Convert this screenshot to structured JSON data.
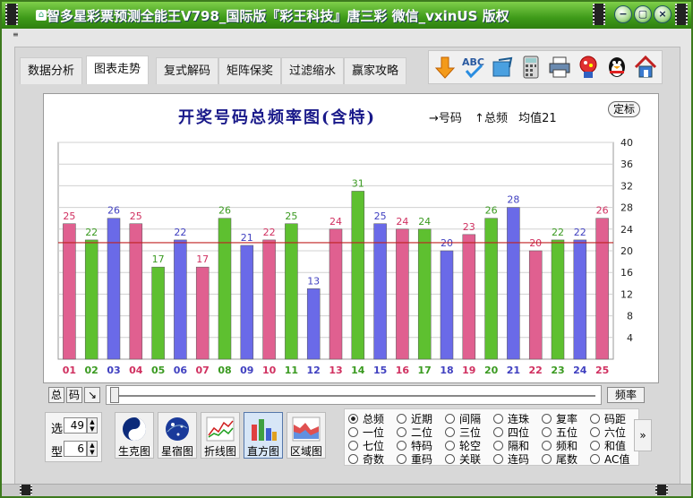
{
  "window": {
    "title": "智多星彩票预测全能王V798_国际版『彩王科技』唐三彩 微信_vxinUS 版权",
    "menu_icon": "≡",
    "controls": [
      "−",
      "▢",
      "×"
    ]
  },
  "tabs": [
    {
      "label": "数据分析"
    },
    {
      "label": "图表走势",
      "active": true
    },
    {
      "label": "复式解码"
    },
    {
      "label": "矩阵保奖"
    },
    {
      "label": "过滤缩水"
    },
    {
      "label": "赢家攻略"
    }
  ],
  "toolbar_icons": [
    "arrow-down-icon",
    "abc-check-icon",
    "export-icon",
    "calculator-icon",
    "printer-icon",
    "lottery-ball-icon",
    "qq-penguin-icon",
    "home-icon"
  ],
  "chart_header": {
    "title": "开奖号码总频率图(含特)",
    "legend_x": "→号码",
    "legend_y": "↑总频",
    "mean_label": "均值21",
    "fix_button": "定标"
  },
  "chart_data": {
    "type": "bar",
    "categories": [
      "01",
      "02",
      "03",
      "04",
      "05",
      "06",
      "07",
      "08",
      "09",
      "10",
      "11",
      "12",
      "13",
      "14",
      "15",
      "16",
      "17",
      "18",
      "19",
      "20",
      "21",
      "22",
      "23",
      "24",
      "25"
    ],
    "values": [
      25,
      22,
      26,
      25,
      17,
      22,
      17,
      26,
      21,
      22,
      25,
      13,
      24,
      31,
      25,
      24,
      24,
      20,
      23,
      26,
      28,
      20,
      22,
      22,
      26
    ],
    "bar_colors": [
      "#e06090",
      "#5ec030",
      "#6a6ae8",
      "#e06090",
      "#5ec030",
      "#6a6ae8",
      "#e06090",
      "#5ec030",
      "#6a6ae8",
      "#e06090",
      "#5ec030",
      "#6a6ae8",
      "#e06090",
      "#5ec030",
      "#6a6ae8",
      "#e06090",
      "#5ec030",
      "#6a6ae8",
      "#e06090",
      "#5ec030",
      "#6a6ae8",
      "#e06090",
      "#5ec030",
      "#6a6ae8",
      "#e06090"
    ],
    "label_colors": [
      "#d03060",
      "#3a9a20",
      "#4040c0"
    ],
    "yticks": [
      4,
      8,
      12,
      16,
      20,
      24,
      28,
      32,
      36,
      40
    ],
    "ylim": [
      0,
      40
    ],
    "mean": 21.5,
    "mean_color": "#c02020",
    "grid": true
  },
  "controls": {
    "left_buttons": [
      "总",
      "码",
      "↘"
    ],
    "freq_button": "频率"
  },
  "spinners": [
    {
      "label": "选",
      "value": "49"
    },
    {
      "label": "型",
      "value": "6"
    }
  ],
  "chart_types": [
    {
      "label": "生克图",
      "icon": "yin-yang-icon"
    },
    {
      "label": "星宿图",
      "icon": "star-globe-icon"
    },
    {
      "label": "折线图",
      "icon": "line-chart-icon"
    },
    {
      "label": "直方图",
      "icon": "bar-chart-icon",
      "active": true
    },
    {
      "label": "区域图",
      "icon": "area-chart-icon"
    }
  ],
  "radio_columns": [
    [
      "总频",
      "一位",
      "七位",
      "奇数"
    ],
    [
      "近期",
      "二位",
      "特码",
      "重码"
    ],
    [
      "间隔",
      "三位",
      "轮空",
      "关联"
    ],
    [
      "连珠",
      "四位",
      "隔和",
      "连码"
    ],
    [
      "复率",
      "五位",
      "频和",
      "尾数"
    ],
    [
      "码距",
      "六位",
      "和值",
      "AC值"
    ]
  ],
  "radio_selected": "总频",
  "more_button": "»"
}
